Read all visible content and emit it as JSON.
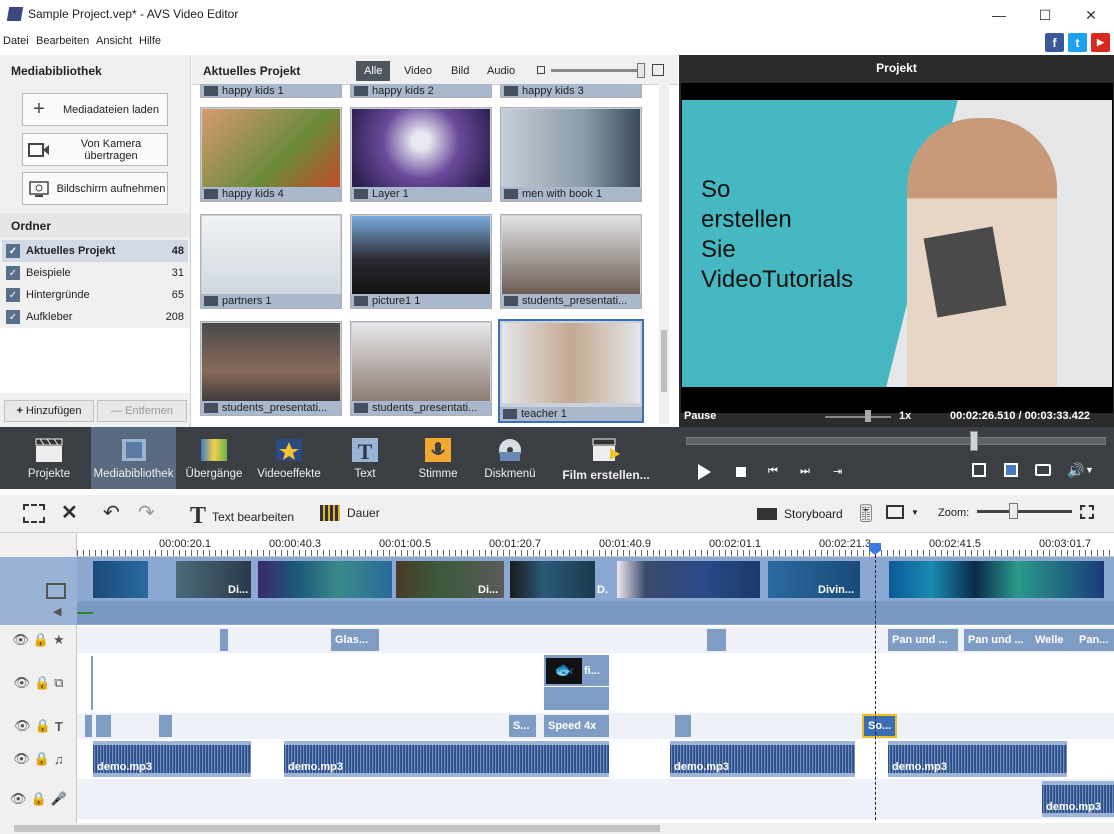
{
  "window": {
    "title": "Sample Project.vep* - AVS Video Editor"
  },
  "menu": [
    "Datei",
    "Bearbeiten",
    "Ansicht",
    "Hilfe"
  ],
  "social": {
    "facebook": "f",
    "twitter": "t",
    "youtube": "▶"
  },
  "media_panel": {
    "title": "Mediabibliothek",
    "buttons": [
      {
        "label": "Mediadateien laden",
        "icon": "plus-icon"
      },
      {
        "label": "Von Kamera übertragen",
        "icon": "camera-icon"
      },
      {
        "label": "Bildschirm aufnehmen",
        "icon": "screen-capture-icon"
      }
    ],
    "folders_title": "Ordner",
    "folders": [
      {
        "name": "Aktuelles Projekt",
        "count": "48"
      },
      {
        "name": "Beispiele",
        "count": "31"
      },
      {
        "name": "Hintergründe",
        "count": "65"
      },
      {
        "name": "Aufkleber",
        "count": "208"
      }
    ],
    "add_label": "Hinzufügen",
    "remove_label": "Entfernen"
  },
  "grid": {
    "title": "Aktuelles Projekt",
    "filters": [
      "Alle",
      "Video",
      "Bild",
      "Audio"
    ],
    "top_row": [
      "happy kids 1",
      "happy kids 2",
      "happy kids 3"
    ],
    "items": [
      {
        "name": "happy kids 4"
      },
      {
        "name": "Layer 1"
      },
      {
        "name": "men with book 1"
      },
      {
        "name": "partners 1"
      },
      {
        "name": "picture1 1"
      },
      {
        "name": "students_presentati..."
      },
      {
        "name": "students_presentati..."
      },
      {
        "name": "students_presentati..."
      },
      {
        "name": "teacher 1"
      }
    ]
  },
  "preview": {
    "title": "Projekt",
    "overlay_text": [
      "So",
      "erstellen",
      "Sie",
      "VideoTutorials"
    ],
    "status": "Pause",
    "speed": "1x",
    "time": "00:02:26.510 / 00:03:33.422",
    "colors": {
      "teal": "#45b8c2",
      "bg": "#e3e4e6"
    }
  },
  "toolbar": [
    {
      "label": "Projekte",
      "icon": "clapper-icon"
    },
    {
      "label": "Mediabibliothek",
      "icon": "film-library-icon"
    },
    {
      "label": "Übergänge",
      "icon": "transitions-icon"
    },
    {
      "label": "Videoeffekte",
      "icon": "video-effects-icon"
    },
    {
      "label": "Text",
      "icon": "text-icon"
    },
    {
      "label": "Stimme",
      "icon": "microphone-icon"
    },
    {
      "label": "Diskmenü",
      "icon": "disc-menu-icon"
    },
    {
      "label": "Film erstellen...",
      "icon": "film-create-icon"
    }
  ],
  "editbar": {
    "edit_text": "Text bearbeiten",
    "duration": "Dauer",
    "storyboard": "Storyboard",
    "zoom": "Zoom:"
  },
  "ruler": [
    "00:00:20.1",
    "00:00:40.3",
    "00:01:00.5",
    "00:01:20.7",
    "00:01:40.9",
    "00:02:01.1",
    "00:02:21.3",
    "00:02:41.5",
    "00:03:01.7"
  ],
  "timeline": {
    "video_labels": [
      "Di...",
      "Di...",
      "D.",
      "Divin..."
    ],
    "effects": [
      "Glas...",
      "Pan und ...",
      "Pan und ...",
      "Welle",
      "Pan..."
    ],
    "overlay_clip": "fi...",
    "text_clips": [
      "S...",
      "Speed 4x",
      "So..."
    ],
    "audio_clips": [
      "demo.mp3",
      "demo.mp3",
      "demo.mp3",
      "demo.mp3"
    ],
    "voice_clip": "demo.mp3"
  }
}
